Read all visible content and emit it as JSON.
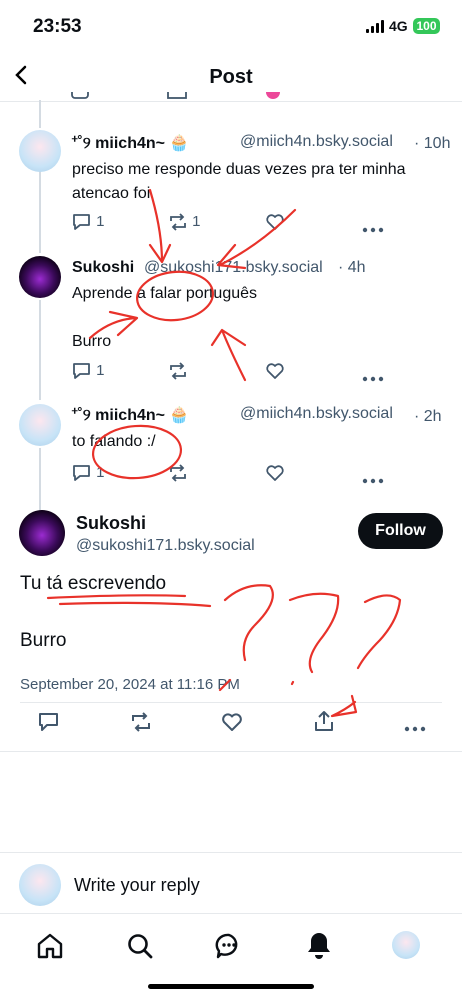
{
  "status_bar": {
    "time": "23:53",
    "network": "4G",
    "battery": "100"
  },
  "header": {
    "title": "Post"
  },
  "replies": [
    {
      "author": "⁺˚୨ miich4n~ 🧁",
      "handle": "@miich4n.bsky.social",
      "time": "· 10h",
      "text": "preciso me  responde  duas  vezes  pra ter minha  atencao foi",
      "reply_count": "1",
      "repost_count": "1"
    },
    {
      "author": "Sukoshi",
      "handle": "@sukoshi171.bsky.social",
      "time": "· 4h",
      "text": "Aprende a falar português\n\nBurro",
      "reply_count": "1",
      "repost_count": ""
    },
    {
      "author": "⁺˚୨ miich4n~ 🧁",
      "handle": "@miich4n.bsky.social",
      "time": "· 2h",
      "text": "to  falando  :/",
      "reply_count": "1",
      "repost_count": ""
    }
  ],
  "main_post": {
    "author": "Sukoshi",
    "handle": "@sukoshi171.bsky.social",
    "follow_label": "Follow",
    "text_line1": "Tu tá escrevendo",
    "text_line2": "Burro",
    "date": "September 20, 2024 at 11:16 PM"
  },
  "composer": {
    "placeholder": "Write your reply"
  },
  "colors": {
    "accent": "#0b0f14",
    "muted": "#42576c",
    "annotation": "#e8322a",
    "battery": "#34c759"
  }
}
